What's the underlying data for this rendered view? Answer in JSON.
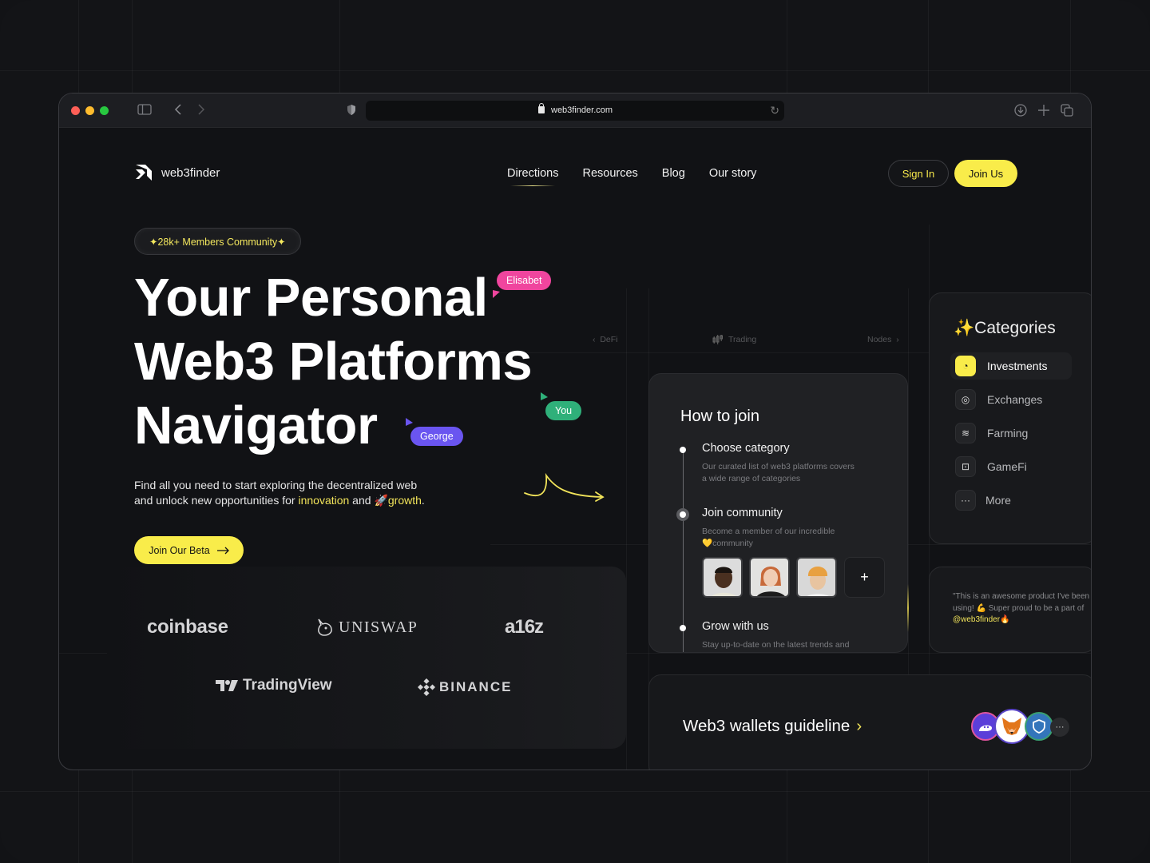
{
  "browser": {
    "url": "web3finder.com",
    "icons": [
      "sidebar-icon",
      "back-icon",
      "forward-icon",
      "shield-icon",
      "lock-icon",
      "reload-icon",
      "download-icon",
      "new-tab-icon",
      "tabs-overview-icon"
    ]
  },
  "site": {
    "logo_text": "web3finder",
    "nav": [
      {
        "label": "Directions",
        "active": true
      },
      {
        "label": "Resources"
      },
      {
        "label": "Blog"
      },
      {
        "label": "Our story"
      }
    ],
    "sign_in": "Sign In",
    "join_us": "Join Us"
  },
  "hero": {
    "badge": "✦28k+ Members Community✦",
    "title_lines": [
      "Your Personal",
      "Web3 Platforms",
      "Navigator"
    ],
    "desc_line1": "Find all you need to start exploring the decentralized web",
    "desc_line2_a": "and unlock new opportunities for ",
    "desc_line2_hl1": "innovation",
    "desc_line2_b": " and ",
    "desc_line2_emoji": "🚀",
    "desc_line2_hl2": "growth",
    "desc_line2_c": ".",
    "cta": "Join Our Beta",
    "cursors": [
      {
        "name": "Elisabet",
        "color": "#f0459e"
      },
      {
        "name": "You",
        "color": "#2fb07a"
      },
      {
        "name": "George",
        "color": "#6a55f0"
      }
    ]
  },
  "partners": {
    "coinbase": "coinbase",
    "uniswap": "UNISWAP",
    "a16z": "a16z",
    "tradingview": "TradingView",
    "binance": "BINANCE"
  },
  "carousel_tabs": {
    "prev": "DeFi",
    "current": "Trading",
    "next": "Nodes"
  },
  "how_to_join": {
    "title": "How to join",
    "steps": [
      {
        "title": "Choose category",
        "desc1": "Our curated list of web3 platforms covers",
        "desc2": "a wide range of categories"
      },
      {
        "title": "Join community",
        "desc1": "Become a member of our incredible",
        "desc2": "💛community"
      },
      {
        "title": "Grow with us",
        "desc1": "Stay up-to-date on the latest trends and",
        "desc2": ""
      }
    ],
    "add_label": "+"
  },
  "categories": {
    "title": "✨Categories",
    "items": [
      {
        "label": "Investments",
        "icon": "pie-chart-icon",
        "active": true
      },
      {
        "label": "Exchanges",
        "icon": "coins-icon"
      },
      {
        "label": "Farming",
        "icon": "stack-coins-icon"
      },
      {
        "label": "GameFi",
        "icon": "gamepad-icon"
      },
      {
        "label": "More",
        "icon": "more-icon"
      }
    ]
  },
  "testimonial": {
    "line1": "\"This is an awesome product I've been",
    "line2": "using! 💪 Super proud to be a part of",
    "handle": "@web3finder",
    "emoji": "🔥"
  },
  "wallets": {
    "title": "Web3 wallets guideline",
    "chevron": "›",
    "more": "···",
    "colors": {
      "phantom": "#5b3fd9",
      "metamask": "#f5841f",
      "trust": "#3375bb"
    }
  },
  "colors": {
    "accent": "#f9ec4a",
    "bg": "#111215",
    "card": "#202124"
  }
}
